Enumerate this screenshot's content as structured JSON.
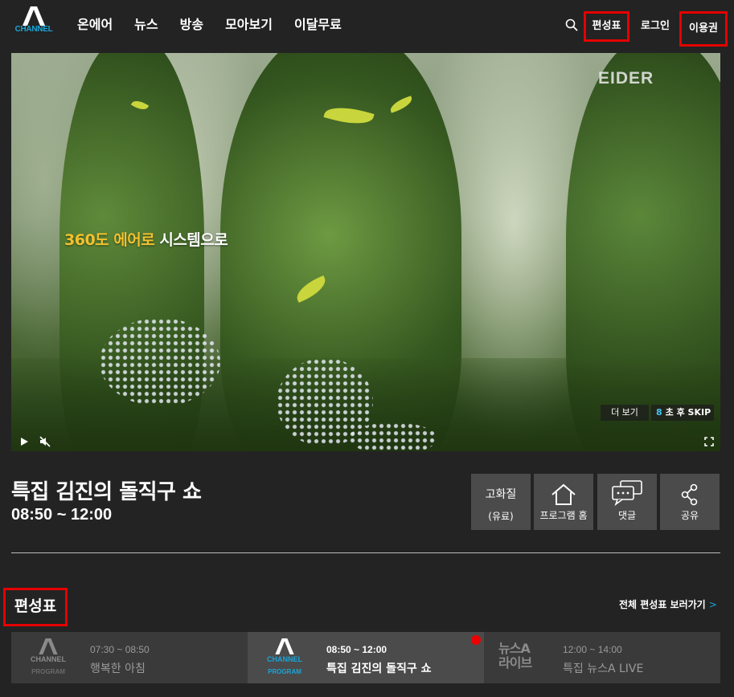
{
  "header": {
    "logo_text": "CHANNEL",
    "nav": [
      "온에어",
      "뉴스",
      "방송",
      "모아보기",
      "이달무료"
    ],
    "schedule_label": "편성표",
    "login_label": "로그인",
    "pass_label": "이용권"
  },
  "video": {
    "caption_accent": "360도 에어로 ",
    "caption_rest": "시스템으로",
    "brand": "EIDER",
    "more_label": "더 보기",
    "skip_count": "8",
    "skip_label": "초 후 SKIP"
  },
  "program": {
    "title": "특집 김진의 돌직구 쇼",
    "time": "08:50 ~ 12:00"
  },
  "actions": {
    "quality_label": "고화질",
    "quality_sub": "(유료)",
    "home_label": "프로그램 홈",
    "comment_label": "댓글",
    "share_label": "공유"
  },
  "schedule": {
    "title": "편성표",
    "full_link": "전체 편성표 보러가기",
    "items": [
      {
        "logo_top": "CHANNEL",
        "logo_bottom": "PROGRAM",
        "time": "07:30 ~ 08:50",
        "name": "행복한 아침"
      },
      {
        "logo_top": "CHANNEL",
        "logo_bottom": "PROGRAM",
        "time": "08:50 ~ 12:00",
        "name": "특집 김진의 돌직구 쇼"
      },
      {
        "logo_top": "뉴스A",
        "logo_bottom": "라이브",
        "time": "12:00 ~ 14:00",
        "name": "특집 뉴스A LIVE"
      }
    ]
  },
  "colors": {
    "background": "#232323",
    "accent_blue": "#1aa5d8",
    "highlight_red": "#e50000",
    "button_gray": "#4b4b4b"
  }
}
